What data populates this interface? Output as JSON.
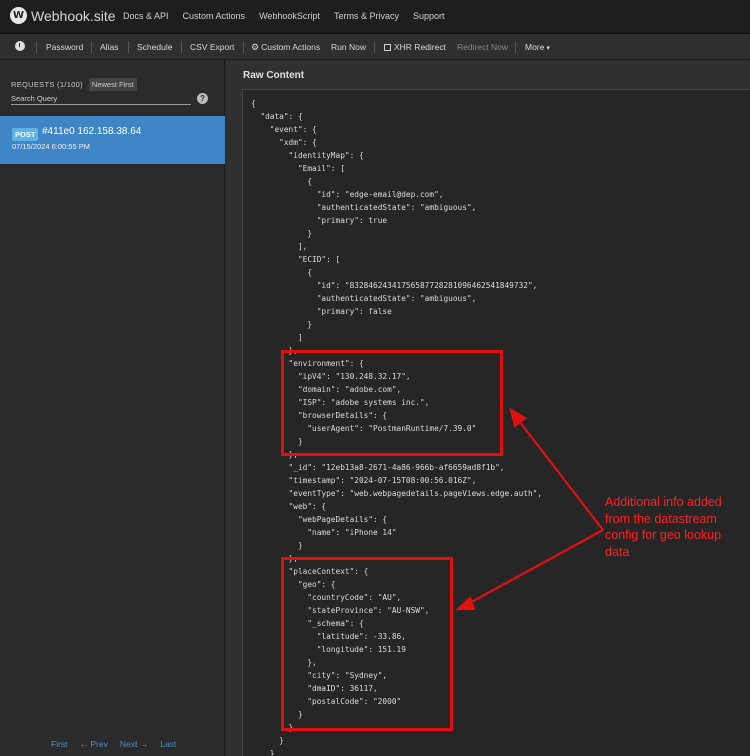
{
  "brand": {
    "name": "Webhook.site",
    "logo_glyph": "W"
  },
  "nav": {
    "links": [
      "Docs & API",
      "Custom Actions",
      "WebhookScript",
      "Terms & Privacy",
      "Support"
    ]
  },
  "toolbar": {
    "clock_icon": "clock-icon",
    "password": "Password",
    "alias": "Alias",
    "schedule": "Schedule",
    "csv_export": "CSV Export",
    "custom_actions": "Custom Actions",
    "run_now": "Run Now",
    "xhr_redirect": "XHR Redirect",
    "redirect_now": "Redirect Now",
    "more": "More"
  },
  "sidebar": {
    "requests_title": "REQUESTS (1/100)",
    "sort_label": "Newest First",
    "search_placeholder": "Search Query",
    "help_glyph": "?",
    "requests": [
      {
        "method": "POST",
        "id_ip": "#411e0 162.158.38.64",
        "time": "07/15/2024 6:00:55 PM"
      }
    ],
    "pager": {
      "first": "First",
      "prev": "← Prev",
      "next": "Next →",
      "last": "Last"
    }
  },
  "main": {
    "title": "Raw Content",
    "raw_json": "{\n  \"data\": {\n    \"event\": {\n      \"xdm\": {\n        \"identityMap\": {\n          \"Email\": [\n            {\n              \"id\": \"edge-email@dep.com\",\n              \"authenticatedState\": \"ambiguous\",\n              \"primary\": true\n            }\n          ],\n          \"ECID\": [\n            {\n              \"id\": \"83284624341756587728281096462541849732\",\n              \"authenticatedState\": \"ambiguous\",\n              \"primary\": false\n            }\n          ]\n        },\n        \"environment\": {\n          \"ipV4\": \"130.248.32.17\",\n          \"domain\": \"adobe.com\",\n          \"ISP\": \"adobe systems inc.\",\n          \"browserDetails\": {\n            \"userAgent\": \"PostmanRuntime/7.39.0\"\n          }\n        },\n        \"_id\": \"12eb13a8-2671-4a86-966b-af6659ad8f1b\",\n        \"timestamp\": \"2024-07-15T08:00:56.016Z\",\n        \"eventType\": \"web.webpagedetails.pageViews.edge.auth\",\n        \"web\": {\n          \"webPageDetails\": {\n            \"name\": \"iPhone 14\"\n          }\n        },\n        \"placeContext\": {\n          \"geo\": {\n            \"countryCode\": \"AU\",\n            \"stateProvince\": \"AU-NSW\",\n            \"_schema\": {\n              \"latitude\": -33.86,\n              \"longitude\": 151.19\n            },\n            \"city\": \"Sydney\",\n            \"dmaID\": 36117,\n            \"postalCode\": \"2000\"\n          }\n        }\n      }\n    }"
  },
  "annotation": {
    "note": "Additional info added from the datastream config for geo lookup data",
    "color": "#e01010"
  }
}
